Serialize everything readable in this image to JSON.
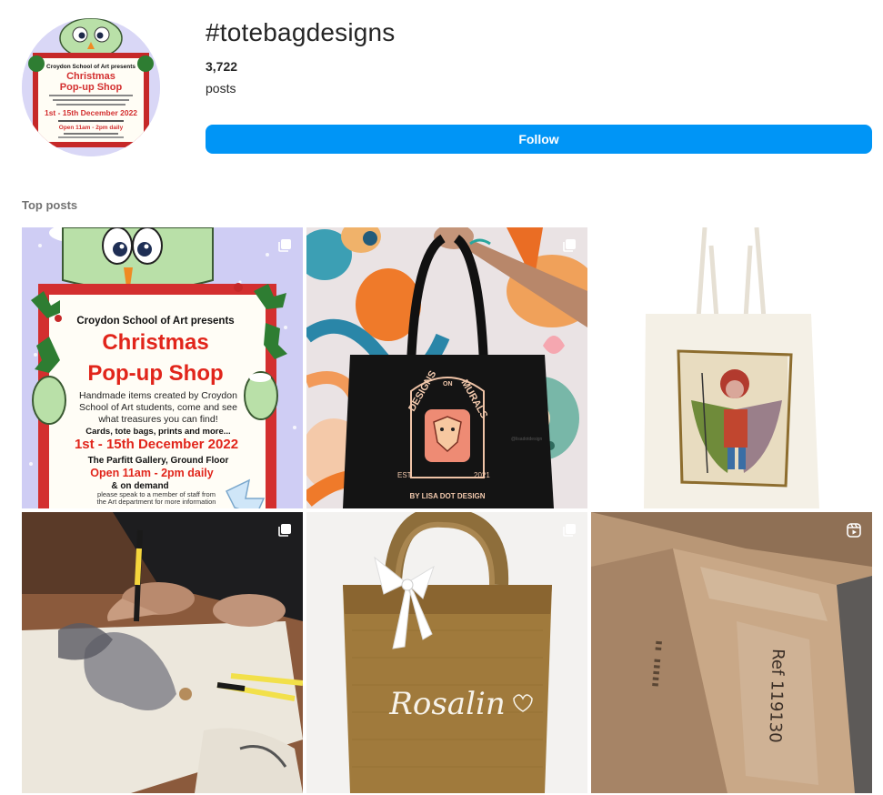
{
  "header": {
    "hashtag": "#totebagdesigns",
    "post_count": "3,722",
    "post_count_label": "posts",
    "follow_label": "Follow"
  },
  "section": {
    "title": "Top posts"
  },
  "colors": {
    "follow_button": "#0095f6",
    "muted_text": "#737373"
  },
  "poster": {
    "presenter": "Croydon School of Art presents",
    "title_line1": "Christmas",
    "title_line2": "Pop-up Shop",
    "blurb_line1": "Handmade items created by Croydon",
    "blurb_line2": "School of Art students, come and see",
    "blurb_line3": "what treasures you can find!",
    "items": "Cards, tote bags, prints and more...",
    "dates": "1st - 15th December 2022",
    "venue": "The Parfitt Gallery, Ground Floor",
    "hours": "Open 11am - 2pm daily",
    "on_demand": "& on demand",
    "note_line1": "please speak to a member of staff from",
    "note_line2": "the Art department for more information"
  },
  "tote": {
    "brand_top": "DESIGNS",
    "brand_on": "ON",
    "brand_bottom": "MURALS",
    "est": "EST.",
    "year": "2021",
    "byline": "BY LISA DOT DESIGN",
    "handle": "@lisadotdesign"
  },
  "jute": {
    "name": "Rosalin"
  },
  "box": {
    "handwriting": "Ref 119130"
  },
  "posts": [
    {
      "id": "post-1",
      "badge": "carousel-icon"
    },
    {
      "id": "post-2",
      "badge": "carousel-icon"
    },
    {
      "id": "post-3",
      "badge": ""
    },
    {
      "id": "post-4",
      "badge": "carousel-icon"
    },
    {
      "id": "post-5",
      "badge": "carousel-icon"
    },
    {
      "id": "post-6",
      "badge": "reel-icon"
    }
  ]
}
